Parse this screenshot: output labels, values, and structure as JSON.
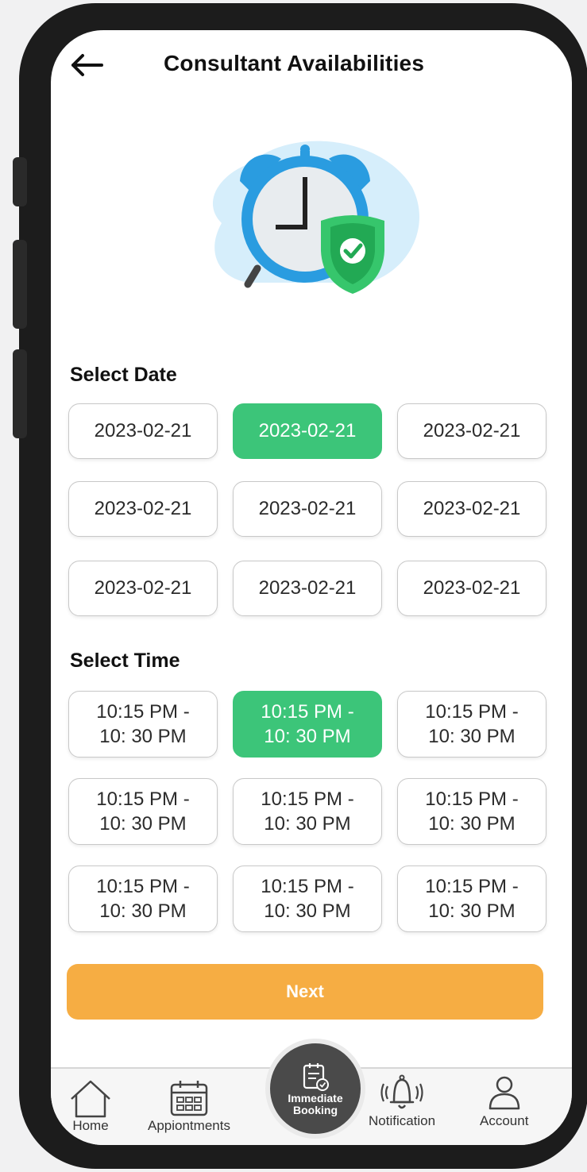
{
  "header": {
    "title": "Consultant Availabilities"
  },
  "date_section": {
    "label": "Select Date",
    "selected_index": 1,
    "dates": [
      "2023-02-21",
      "2023-02-21",
      "2023-02-21",
      "2023-02-21",
      "2023-02-21",
      "2023-02-21",
      "2023-02-21",
      "2023-02-21",
      "2023-02-21"
    ]
  },
  "time_section": {
    "label": "Select Time",
    "selected_index": 1,
    "times": [
      "10:15 PM -\n10: 30 PM",
      "10:15 PM -\n10: 30 PM",
      "10:15 PM -\n10: 30 PM",
      "10:15 PM -\n10: 30 PM",
      "10:15 PM -\n10: 30 PM",
      "10:15 PM -\n10: 30 PM",
      "10:15 PM -\n10: 30 PM",
      "10:15 PM -\n10: 30 PM",
      "10:15 PM -\n10: 30 PM"
    ]
  },
  "next_label": "Next",
  "nav": {
    "home": "Home",
    "appointments": "Appiontments",
    "immediate_line1": "Immediate",
    "immediate_line2": "Booking",
    "notification": "Notification",
    "account": "Account"
  },
  "colors": {
    "accent_green": "#3cc579",
    "next_orange": "#f6ad43"
  }
}
